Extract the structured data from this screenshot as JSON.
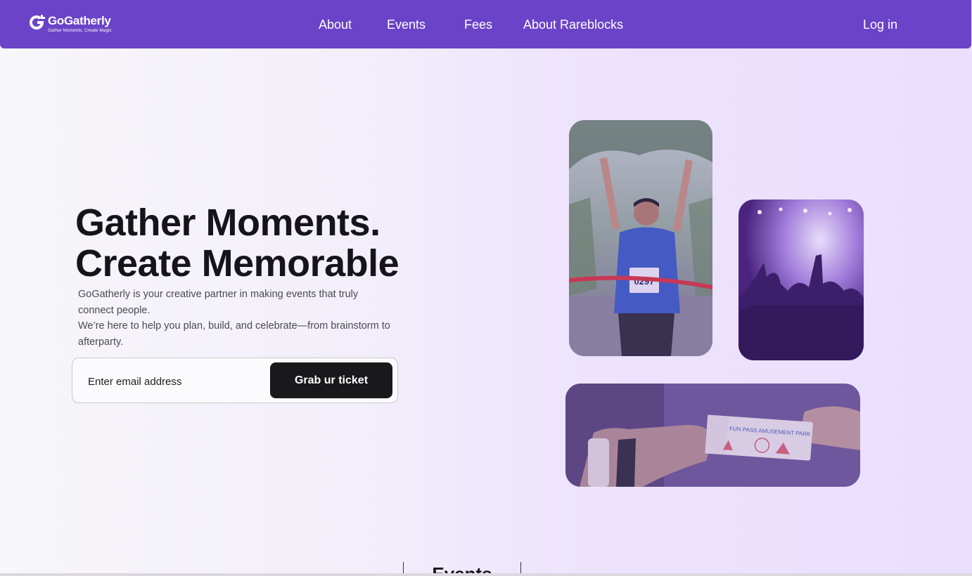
{
  "brand": {
    "name": "GoGatherly",
    "tagline": "Gather Moments. Create Magic"
  },
  "nav": {
    "links": [
      "About",
      "Events",
      "Fees",
      "About Rareblocks"
    ],
    "login": "Log in"
  },
  "hero": {
    "title_line1": "Gather Moments.",
    "title_line2": "Create Memorable",
    "desc_line1": "GoGatherly is your creative partner in making events that truly",
    "desc_line2": "connect people.",
    "desc_line3": "We’re here to help you plan, build, and celebrate—from brainstorm to",
    "desc_line4": "afterparty.",
    "email_placeholder": "Enter email address",
    "cta_label": "Grab ur ticket"
  },
  "gallery": {
    "photo1": {
      "bib_number": "0297"
    },
    "ticket_text": "FUN PASS AMUSEMENT PARK"
  },
  "events": {
    "heading": "Events"
  },
  "colors": {
    "nav_bg": "#6a43c8",
    "cta_bg": "#19191c",
    "text_dark": "#15141b",
    "overlay_purple": "#5b2e9c"
  },
  "icons": [
    "gogatherly-logo-icon"
  ]
}
